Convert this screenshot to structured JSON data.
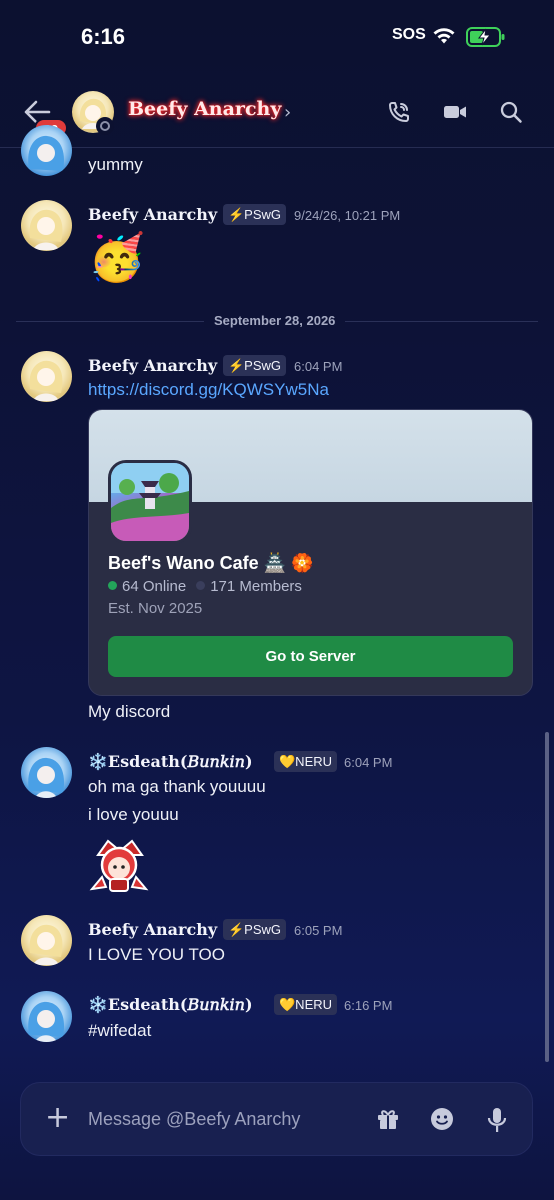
{
  "status_bar": {
    "time": "6:16",
    "sos": "SOS"
  },
  "header": {
    "unread_count": "99",
    "title": "Beefy Anarchy",
    "chevron": "›"
  },
  "messages": {
    "m0": {
      "text": "yummy"
    },
    "m1": {
      "author": "Beefy Anarchy",
      "tag": "⚡PSwG",
      "timestamp": "9/24/26, 10:21 PM",
      "emoji": "🥳"
    },
    "divider": "September 28, 2026",
    "m2": {
      "author": "Beefy Anarchy",
      "tag": "⚡PSwG",
      "timestamp": "6:04 PM",
      "link": "https://discord.gg/KQWSYw5Na",
      "after": "My discord"
    },
    "m3": {
      "author": "❄️𝐄𝐬𝐝𝐞𝐚𝐭𝐡(𝐵𝑢𝑛𝑘𝑖𝑛)",
      "tag": "💛NERU",
      "timestamp": "6:04 PM",
      "line1": "oh ma ga thank youuuu",
      "line2": "i love youuu"
    },
    "m4": {
      "author": "Beefy Anarchy",
      "tag": "⚡PSwG",
      "timestamp": "6:05 PM",
      "text": "I LOVE YOU TOO"
    },
    "m5": {
      "author": "❄️𝐄𝐬𝐝𝐞𝐚𝐭𝐡(𝐵𝑢𝑛𝑘𝑖𝑛)",
      "tag": "💛NERU",
      "timestamp": "6:16 PM",
      "text": "#wifedat"
    }
  },
  "invite": {
    "server_name": "Beef's Wano Cafe 🏯 🏵️",
    "online": "64 Online",
    "members": "171 Members",
    "established": "Est. Nov 2025",
    "button": "Go to Server"
  },
  "composer": {
    "placeholder": "Message @Beefy Anarchy"
  },
  "colors": {
    "background": "#0d1236",
    "accent_green": "#1f8b45",
    "link": "#5aa7ff",
    "badge_red": "#e03b3b",
    "name_glow": "#ff2a2a"
  },
  "icons": [
    "back-arrow-icon",
    "call-icon",
    "video-icon",
    "search-icon",
    "plus-icon",
    "gift-icon",
    "emoji-icon",
    "mic-icon",
    "wifi-icon",
    "battery-icon"
  ]
}
